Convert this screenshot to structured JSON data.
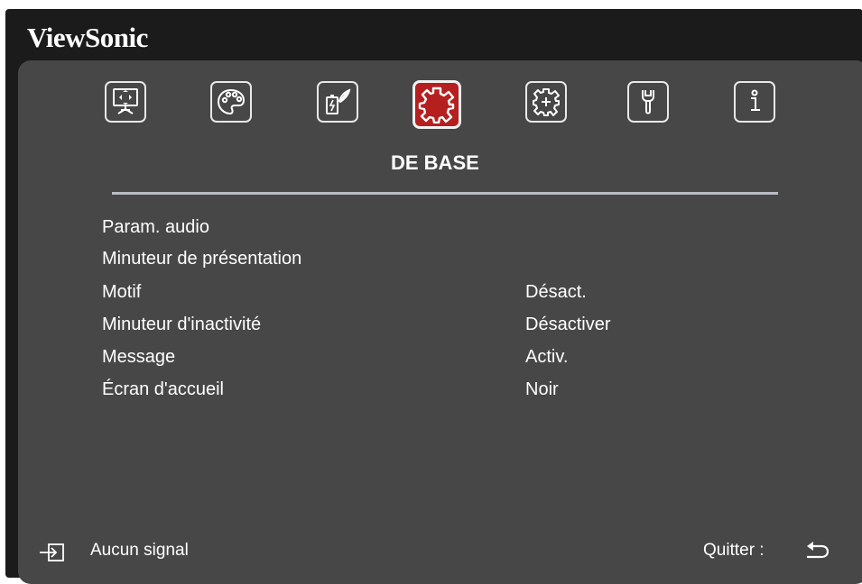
{
  "brand": "ViewSonic",
  "tabs": [
    {
      "icon": "display-icon",
      "active": false
    },
    {
      "icon": "picture-palette-icon",
      "active": false
    },
    {
      "icon": "power-management-icon",
      "active": false
    },
    {
      "icon": "basic-settings-gear-icon",
      "active": true
    },
    {
      "icon": "advanced-settings-gear-icon",
      "active": false
    },
    {
      "icon": "system-wrench-icon",
      "active": false
    },
    {
      "icon": "information-icon",
      "active": false
    }
  ],
  "active_tab_title": "DE BASE",
  "menu": [
    {
      "label": "Param. audio",
      "value": ""
    },
    {
      "label": "Minuteur de présentation",
      "value": ""
    },
    {
      "label": "Motif",
      "value": "Désact."
    },
    {
      "label": "Minuteur d'inactivité",
      "value": "Désactiver"
    },
    {
      "label": "Message",
      "value": "Activ."
    },
    {
      "label": "Écran d'accueil",
      "value": "Noir"
    }
  ],
  "footer": {
    "signal_text": "Aucun signal",
    "quit_text": "Quitter :"
  },
  "colors": {
    "active_tab": "#b51f1f",
    "panel": "#474747",
    "frame": "#1b1b1b"
  }
}
